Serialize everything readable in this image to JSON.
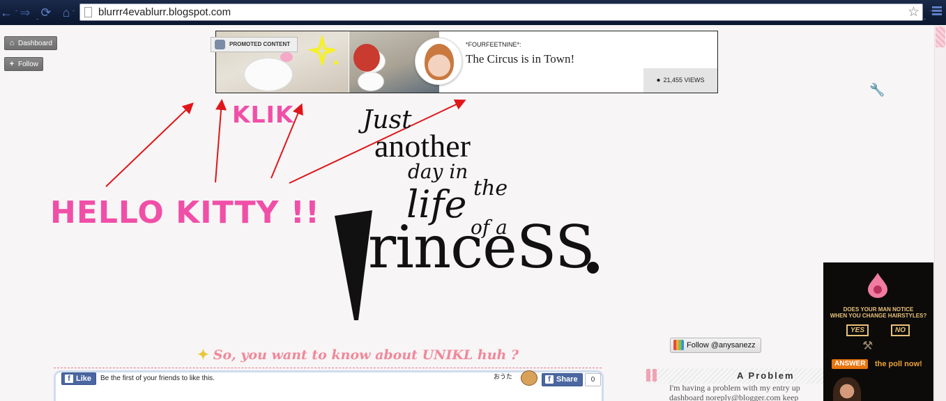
{
  "browser": {
    "url": "blurrr4evablurr.blogspot.com"
  },
  "blogger_nav": {
    "dashboard_label": "Dashboard",
    "follow_label": "Follow"
  },
  "promoted": {
    "label": "PROMOTED CONTENT",
    "author": "*FOURFEETNINE*:",
    "title": "The Circus is in Town!",
    "views": "21,455 VIEWS"
  },
  "header": {
    "hello": "HELLO KITTY !!",
    "klik": "KLIK",
    "tagline": {
      "just": "Just",
      "another": "another",
      "day_in": "day in",
      "the": "the",
      "life": "life",
      "of_a": "of a",
      "princess": "rinceSS"
    },
    "arrow_color": "#e0161b",
    "pink": "#f04fa8"
  },
  "post": {
    "section_title": "So, you want to know about UNIKL huh ?",
    "fb_like_label": "Like",
    "fb_like_text": "Be the first of your friends to like this.",
    "stamp_text": "おうた",
    "fb_share_label": "Share",
    "share_count": "0"
  },
  "sidebar": {
    "instagram_follow": "Follow  @anysanezz",
    "widget_title": "A Problem",
    "widget_text_line1": "I'm having a problem with my entry up",
    "widget_text_line2": "dashboard  noreply@blogger.com keep"
  },
  "ad": {
    "question_line1": "DOES YOUR MAN NOTICE",
    "question_line2": "WHEN YOU CHANGE HAIRSTYLES?",
    "yes": "YES",
    "no": "NO",
    "answer": "ANSWER",
    "poll_text": "the poll now!"
  }
}
